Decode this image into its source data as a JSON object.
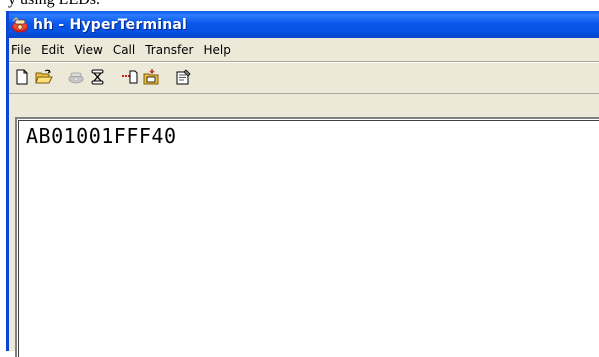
{
  "caption": "y using LEDs.",
  "window": {
    "title": "hh - HyperTerminal",
    "icon": "hyperterminal-phone-icon"
  },
  "menu": {
    "items": [
      "File",
      "Edit",
      "View",
      "Call",
      "Transfer",
      "Help"
    ]
  },
  "toolbar": {
    "buttons": [
      {
        "name": "new-icon"
      },
      {
        "name": "open-folder-icon"
      },
      {
        "name": "disconnect-phone-icon"
      },
      {
        "name": "connect-icon"
      },
      {
        "name": "send-file-icon"
      },
      {
        "name": "receive-file-icon"
      },
      {
        "name": "properties-icon"
      }
    ]
  },
  "terminal": {
    "text": "AB01001FFF40"
  }
}
